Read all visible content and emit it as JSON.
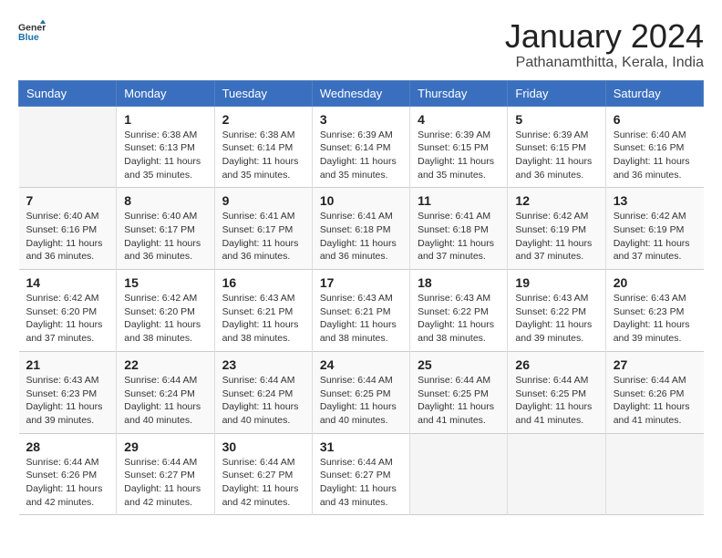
{
  "logo": {
    "line1": "General",
    "line2": "Blue"
  },
  "title": "January 2024",
  "location": "Pathanamthitta, Kerala, India",
  "days_of_week": [
    "Sunday",
    "Monday",
    "Tuesday",
    "Wednesday",
    "Thursday",
    "Friday",
    "Saturday"
  ],
  "weeks": [
    [
      {
        "day": "",
        "info": ""
      },
      {
        "day": "1",
        "info": "Sunrise: 6:38 AM\nSunset: 6:13 PM\nDaylight: 11 hours\nand 35 minutes."
      },
      {
        "day": "2",
        "info": "Sunrise: 6:38 AM\nSunset: 6:14 PM\nDaylight: 11 hours\nand 35 minutes."
      },
      {
        "day": "3",
        "info": "Sunrise: 6:39 AM\nSunset: 6:14 PM\nDaylight: 11 hours\nand 35 minutes."
      },
      {
        "day": "4",
        "info": "Sunrise: 6:39 AM\nSunset: 6:15 PM\nDaylight: 11 hours\nand 35 minutes."
      },
      {
        "day": "5",
        "info": "Sunrise: 6:39 AM\nSunset: 6:15 PM\nDaylight: 11 hours\nand 36 minutes."
      },
      {
        "day": "6",
        "info": "Sunrise: 6:40 AM\nSunset: 6:16 PM\nDaylight: 11 hours\nand 36 minutes."
      }
    ],
    [
      {
        "day": "7",
        "info": "Sunrise: 6:40 AM\nSunset: 6:16 PM\nDaylight: 11 hours\nand 36 minutes."
      },
      {
        "day": "8",
        "info": "Sunrise: 6:40 AM\nSunset: 6:17 PM\nDaylight: 11 hours\nand 36 minutes."
      },
      {
        "day": "9",
        "info": "Sunrise: 6:41 AM\nSunset: 6:17 PM\nDaylight: 11 hours\nand 36 minutes."
      },
      {
        "day": "10",
        "info": "Sunrise: 6:41 AM\nSunset: 6:18 PM\nDaylight: 11 hours\nand 36 minutes."
      },
      {
        "day": "11",
        "info": "Sunrise: 6:41 AM\nSunset: 6:18 PM\nDaylight: 11 hours\nand 37 minutes."
      },
      {
        "day": "12",
        "info": "Sunrise: 6:42 AM\nSunset: 6:19 PM\nDaylight: 11 hours\nand 37 minutes."
      },
      {
        "day": "13",
        "info": "Sunrise: 6:42 AM\nSunset: 6:19 PM\nDaylight: 11 hours\nand 37 minutes."
      }
    ],
    [
      {
        "day": "14",
        "info": "Sunrise: 6:42 AM\nSunset: 6:20 PM\nDaylight: 11 hours\nand 37 minutes."
      },
      {
        "day": "15",
        "info": "Sunrise: 6:42 AM\nSunset: 6:20 PM\nDaylight: 11 hours\nand 38 minutes."
      },
      {
        "day": "16",
        "info": "Sunrise: 6:43 AM\nSunset: 6:21 PM\nDaylight: 11 hours\nand 38 minutes."
      },
      {
        "day": "17",
        "info": "Sunrise: 6:43 AM\nSunset: 6:21 PM\nDaylight: 11 hours\nand 38 minutes."
      },
      {
        "day": "18",
        "info": "Sunrise: 6:43 AM\nSunset: 6:22 PM\nDaylight: 11 hours\nand 38 minutes."
      },
      {
        "day": "19",
        "info": "Sunrise: 6:43 AM\nSunset: 6:22 PM\nDaylight: 11 hours\nand 39 minutes."
      },
      {
        "day": "20",
        "info": "Sunrise: 6:43 AM\nSunset: 6:23 PM\nDaylight: 11 hours\nand 39 minutes."
      }
    ],
    [
      {
        "day": "21",
        "info": "Sunrise: 6:43 AM\nSunset: 6:23 PM\nDaylight: 11 hours\nand 39 minutes."
      },
      {
        "day": "22",
        "info": "Sunrise: 6:44 AM\nSunset: 6:24 PM\nDaylight: 11 hours\nand 40 minutes."
      },
      {
        "day": "23",
        "info": "Sunrise: 6:44 AM\nSunset: 6:24 PM\nDaylight: 11 hours\nand 40 minutes."
      },
      {
        "day": "24",
        "info": "Sunrise: 6:44 AM\nSunset: 6:25 PM\nDaylight: 11 hours\nand 40 minutes."
      },
      {
        "day": "25",
        "info": "Sunrise: 6:44 AM\nSunset: 6:25 PM\nDaylight: 11 hours\nand 41 minutes."
      },
      {
        "day": "26",
        "info": "Sunrise: 6:44 AM\nSunset: 6:25 PM\nDaylight: 11 hours\nand 41 minutes."
      },
      {
        "day": "27",
        "info": "Sunrise: 6:44 AM\nSunset: 6:26 PM\nDaylight: 11 hours\nand 41 minutes."
      }
    ],
    [
      {
        "day": "28",
        "info": "Sunrise: 6:44 AM\nSunset: 6:26 PM\nDaylight: 11 hours\nand 42 minutes."
      },
      {
        "day": "29",
        "info": "Sunrise: 6:44 AM\nSunset: 6:27 PM\nDaylight: 11 hours\nand 42 minutes."
      },
      {
        "day": "30",
        "info": "Sunrise: 6:44 AM\nSunset: 6:27 PM\nDaylight: 11 hours\nand 42 minutes."
      },
      {
        "day": "31",
        "info": "Sunrise: 6:44 AM\nSunset: 6:27 PM\nDaylight: 11 hours\nand 43 minutes."
      },
      {
        "day": "",
        "info": ""
      },
      {
        "day": "",
        "info": ""
      },
      {
        "day": "",
        "info": ""
      }
    ]
  ]
}
